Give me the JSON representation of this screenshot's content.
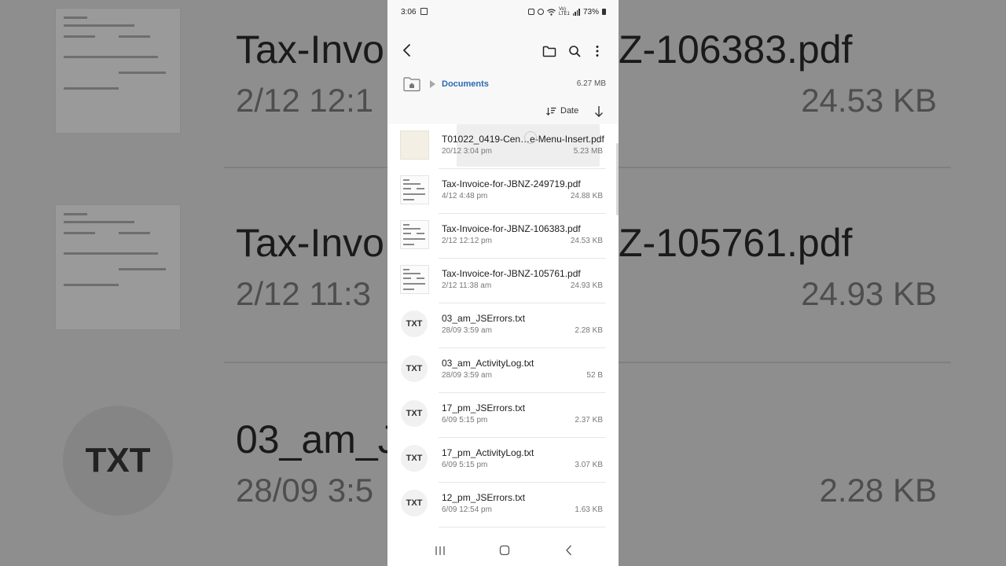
{
  "status": {
    "time": "3:06",
    "network_label": "Vo) LTE1",
    "battery": "73%"
  },
  "appbar": {
    "back_icon": "arrow-left-icon",
    "folder_icon": "folder-icon",
    "search_icon": "search-icon",
    "more_icon": "more-vertical-icon"
  },
  "path": {
    "folder": "Documents",
    "size": "6.27 MB"
  },
  "sort": {
    "label": "Date"
  },
  "files": [
    {
      "name": "T01022_0419-Cen…e-Menu-Insert.pdf",
      "date": "20/12 3:04 pm",
      "size": "5.23 MB",
      "kind": "pdf"
    },
    {
      "name": "Tax-Invoice-for-JBNZ-249719.pdf",
      "date": "4/12 4:48 pm",
      "size": "24.88 KB",
      "kind": "pdf"
    },
    {
      "name": "Tax-Invoice-for-JBNZ-106383.pdf",
      "date": "2/12 12:12 pm",
      "size": "24.53 KB",
      "kind": "pdf"
    },
    {
      "name": "Tax-Invoice-for-JBNZ-105761.pdf",
      "date": "2/12 11:38 am",
      "size": "24.93 KB",
      "kind": "pdf"
    },
    {
      "name": "03_am_JSErrors.txt",
      "date": "28/09 3:59 am",
      "size": "2.28 KB",
      "kind": "txt",
      "icon": "TXT"
    },
    {
      "name": "03_am_ActivityLog.txt",
      "date": "28/09 3:59 am",
      "size": "52 B",
      "kind": "txt",
      "icon": "TXT"
    },
    {
      "name": "17_pm_JSErrors.txt",
      "date": "6/09 5:15 pm",
      "size": "2.37 KB",
      "kind": "txt",
      "icon": "TXT"
    },
    {
      "name": "17_pm_ActivityLog.txt",
      "date": "6/09 5:15 pm",
      "size": "3.07 KB",
      "kind": "txt",
      "icon": "TXT"
    },
    {
      "name": "12_pm_JSErrors.txt",
      "date": "6/09 12:54 pm",
      "size": "1.63 KB",
      "kind": "txt",
      "icon": "TXT"
    }
  ],
  "background": {
    "row1_name": "Tax-Invo",
    "row1_name_right": "Z-106383.pdf",
    "row1_meta": "2/12 12:1",
    "row1_size": "24.53 KB",
    "row2_name": "Tax-Invo",
    "row2_name_right": "Z-105761.pdf",
    "row2_meta": "2/12 11:3",
    "row2_size": "24.93 KB",
    "row3_name": "03_am_J",
    "row3_meta": "28/09 3:5",
    "row3_size": "2.28 KB",
    "row3_icon": "TXT"
  },
  "nav": {
    "recents_icon": "recents-icon",
    "home_icon": "home-icon",
    "back_icon": "nav-back-icon"
  }
}
